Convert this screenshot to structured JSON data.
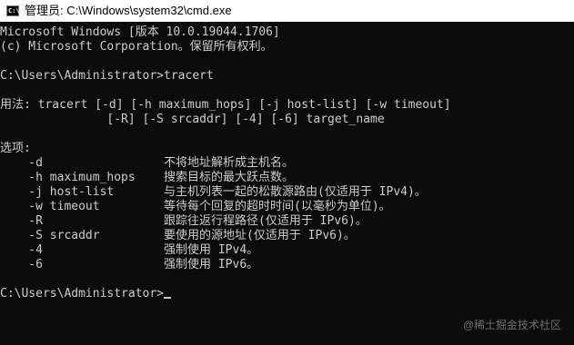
{
  "window": {
    "title": "管理员: C:\\Windows\\system32\\cmd.exe",
    "icon": "cmd-icon",
    "icon_text": "C:\\"
  },
  "console": {
    "lines": [
      "Microsoft Windows [版本 10.0.19044.1706]",
      "(c) Microsoft Corporation。保留所有权利。",
      "",
      "C:\\Users\\Administrator>tracert",
      "",
      "用法: tracert [-d] [-h maximum_hops] [-j host-list] [-w timeout]",
      "               [-R] [-S srcaddr] [-4] [-6] target_name",
      "",
      "选项:",
      "    -d                 不将地址解析成主机名。",
      "    -h maximum_hops    搜索目标的最大跃点数。",
      "    -j host-list       与主机列表一起的松散源路由(仅适用于 IPv4)。",
      "    -w timeout         等待每个回复的超时时间(以毫秒为单位)。",
      "    -R                 跟踪往返行程路径(仅适用于 IPv6)。",
      "    -S srcaddr         要使用的源地址(仅适用于 IPv6)。",
      "    -4                 强制使用 IPv4。",
      "    -6                 强制使用 IPv6。",
      "",
      "C:\\Users\\Administrator>"
    ]
  },
  "watermark": "@稀土掘金技术社区"
}
